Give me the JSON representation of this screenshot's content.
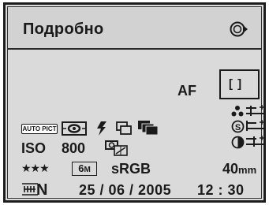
{
  "header": {
    "title": "Подробно",
    "nav_icon": "playback-nav-icon"
  },
  "focus": {
    "mode_label": "AF",
    "frame_label": "[ ]"
  },
  "adjustments": {
    "sharpness_icon": "sharpness-icon",
    "saturation_icon": "saturation-icon",
    "contrast_icon": "contrast-icon",
    "sharpness_level": 0,
    "saturation_level": 0,
    "contrast_level": 0
  },
  "shooting": {
    "picture_mode_badge": "AUTO PICT",
    "metering_icon": "multi-segment-metering-icon",
    "flash_icon": "flash-icon",
    "drive_icon": "continuous-shooting-icon",
    "bracket_icon": "bracket-icon",
    "iso_label": "ISO",
    "iso_value": "800",
    "wb_icon": "white-balance-icon"
  },
  "file": {
    "quality": "★★★",
    "size_badge": "6",
    "size_unit": "M",
    "color_space": "sRGB",
    "focal_length": "40",
    "focal_unit": "mm"
  },
  "footer": {
    "nr_icon": "noise-reduction-icon",
    "nr_label": "N",
    "date": "25 / 06 / 2005",
    "time": "12 : 30"
  },
  "colors": {
    "background": "#dadada",
    "header_bg": "#d2d2d2",
    "text": "#1a1a1a",
    "border": "#1d1d1d"
  }
}
